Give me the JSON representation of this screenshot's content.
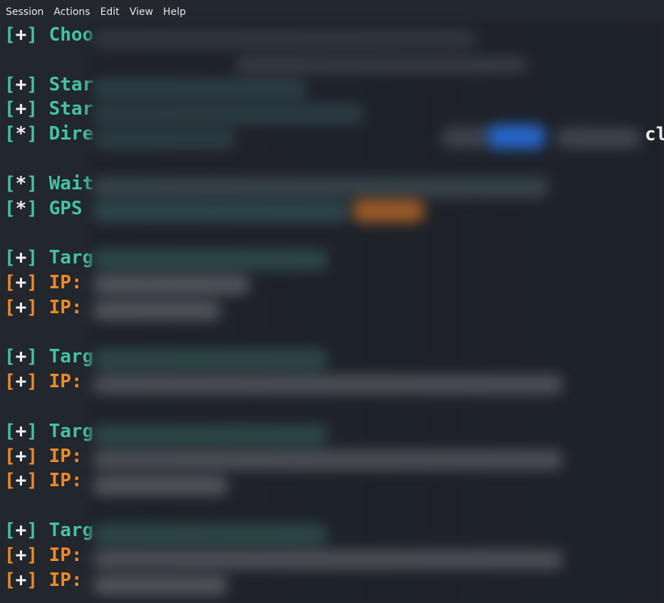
{
  "menubar": {
    "items": [
      "Session",
      "Actions",
      "Edit",
      "View",
      "Help"
    ]
  },
  "terminal": {
    "lines": [
      {
        "marker": "[+]",
        "text": "Choo",
        "color": "teal"
      },
      {
        "marker": "",
        "text": "",
        "color": "teal"
      },
      {
        "marker": "[+]",
        "text": "Star",
        "color": "teal"
      },
      {
        "marker": "[+]",
        "text": "Star",
        "color": "teal"
      },
      {
        "marker": "[*]",
        "text": "Dire",
        "color": "teal"
      },
      {
        "marker": "",
        "text": "",
        "color": "teal"
      },
      {
        "marker": "[*]",
        "text": "Wait",
        "color": "teal"
      },
      {
        "marker": "[*]",
        "text": "GPS",
        "color": "teal"
      },
      {
        "marker": "",
        "text": "",
        "color": "teal"
      },
      {
        "marker": "[+]",
        "text": "Targ",
        "color": "teal"
      },
      {
        "marker": "[+]",
        "text": "IP:",
        "color": "orange"
      },
      {
        "marker": "[+]",
        "text": "IP:",
        "color": "orange"
      },
      {
        "marker": "",
        "text": "",
        "color": "teal"
      },
      {
        "marker": "[+]",
        "text": "Targ",
        "color": "teal"
      },
      {
        "marker": "[+]",
        "text": "IP:",
        "color": "orange"
      },
      {
        "marker": "",
        "text": "",
        "color": "teal"
      },
      {
        "marker": "[+]",
        "text": "Targ",
        "color": "teal"
      },
      {
        "marker": "[+]",
        "text": "IP:",
        "color": "orange"
      },
      {
        "marker": "[+]",
        "text": "IP:",
        "color": "orange"
      },
      {
        "marker": "",
        "text": "",
        "color": "teal"
      },
      {
        "marker": "[+]",
        "text": "Targ",
        "color": "teal"
      },
      {
        "marker": "[+]",
        "text": "IP:",
        "color": "orange"
      },
      {
        "marker": "[+]",
        "text": "IP:",
        "color": "orange"
      }
    ],
    "tail_text": "cl"
  },
  "colors": {
    "background": "#22262d",
    "teal": "#46c2a6",
    "orange": "#f08a24",
    "menu_text": "#e6e6e6"
  }
}
